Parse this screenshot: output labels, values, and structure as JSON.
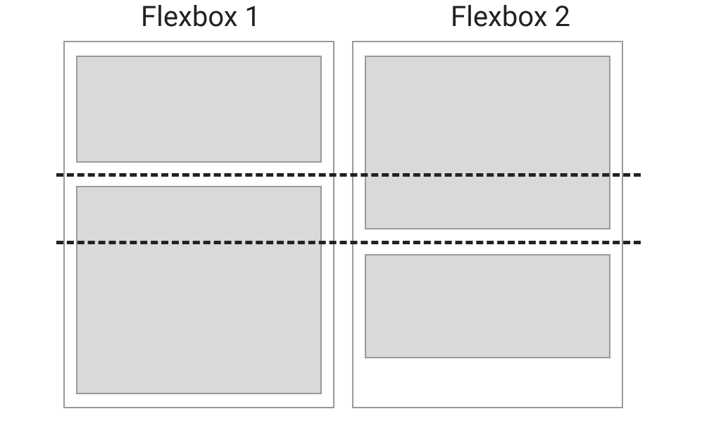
{
  "diagram": {
    "title_left": "Flexbox 1",
    "title_right": "Flexbox 2",
    "container_left": {
      "label": "flexbox-1-container",
      "items": [
        {
          "label": "flexbox-1-item-top"
        },
        {
          "label": "flexbox-1-item-bottom"
        }
      ]
    },
    "container_right": {
      "label": "flexbox-2-container",
      "items": [
        {
          "label": "flexbox-2-item-top"
        },
        {
          "label": "flexbox-2-item-bottom"
        }
      ]
    },
    "guide_lines": [
      {
        "label": "alignment-guide-upper"
      },
      {
        "label": "alignment-guide-lower"
      }
    ],
    "colors": {
      "item_fill": "#d9d9d9",
      "border": "#9a9a9a",
      "text": "#222222",
      "dash": "#222222"
    }
  }
}
